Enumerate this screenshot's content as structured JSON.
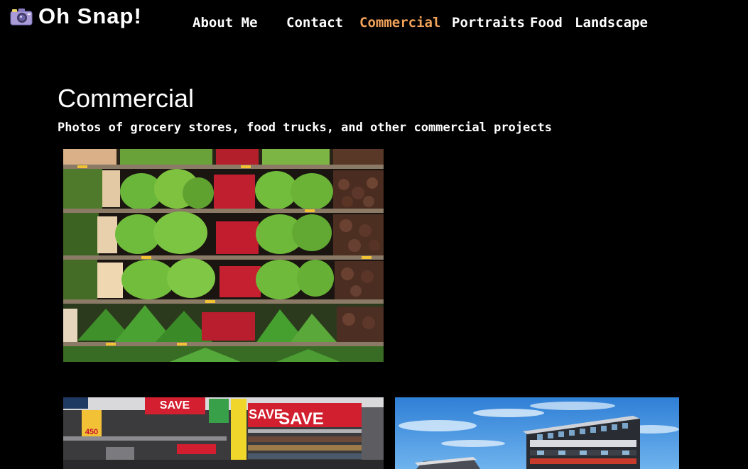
{
  "header": {
    "brand": "Oh Snap!",
    "logo_icon": "camera-icon"
  },
  "nav": {
    "items": [
      {
        "label": "About Me",
        "active": false
      },
      {
        "label": "Contact",
        "active": false
      },
      {
        "label": "Commercial",
        "active": true
      },
      {
        "label": "Portraits",
        "active": false
      },
      {
        "label": "Food",
        "active": false
      },
      {
        "label": "Landscape",
        "active": false
      }
    ]
  },
  "page": {
    "title": "Commercial",
    "subtitle": "Photos of grocery stores, food trucks, and other commercial projects"
  },
  "gallery": {
    "grocery_sign_1": "SAVE",
    "grocery_sign_2": "SAVE",
    "grocery_sign_3": "SAVE",
    "grocery_price": "450"
  },
  "colors": {
    "background": "#000000",
    "text": "#ffffff",
    "nav_active": "#f2a35a"
  }
}
